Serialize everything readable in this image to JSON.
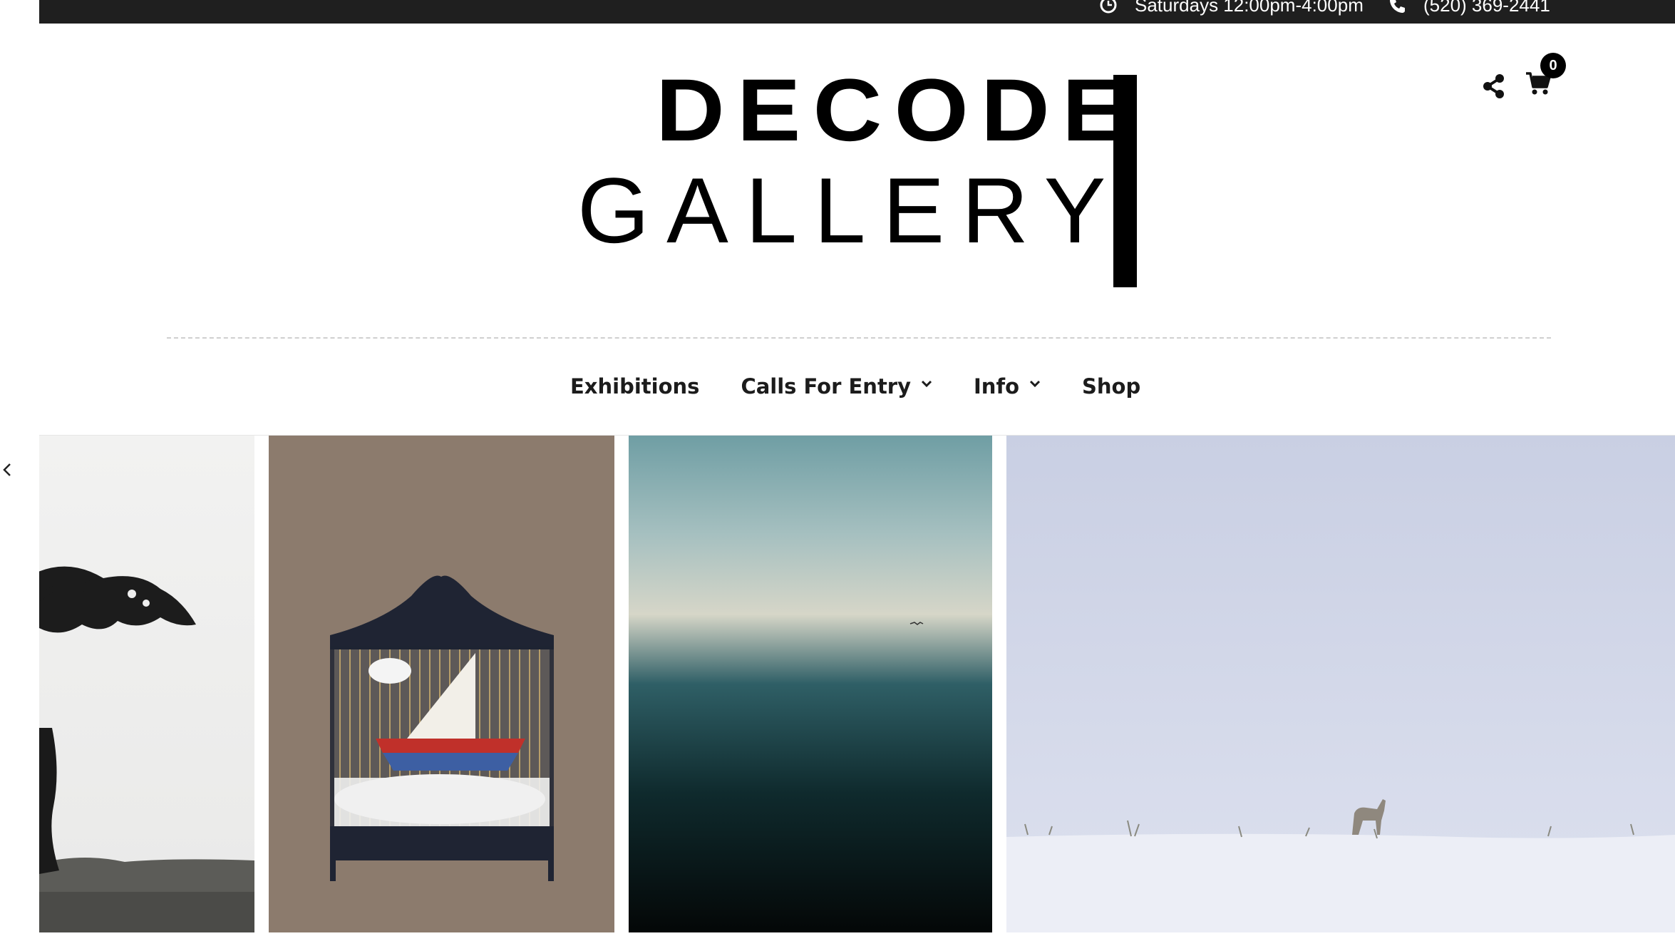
{
  "topbar": {
    "hours": "Saturdays 12:00pm-4:00pm",
    "phone": "(520) 369-2441",
    "background": "#1f1f1f"
  },
  "logo": {
    "line1": "DECODE",
    "line2": "GALLERY"
  },
  "header": {
    "share_icon": "share-icon",
    "cart_icon": "cart-icon",
    "cart_count": "0"
  },
  "nav": {
    "items": [
      {
        "label": "Exhibitions",
        "has_dropdown": false
      },
      {
        "label": "Calls For Entry",
        "has_dropdown": true
      },
      {
        "label": "Info",
        "has_dropdown": true
      },
      {
        "label": "Shop",
        "has_dropdown": false
      }
    ]
  },
  "slider": {
    "prev_icon": "chevron-left-icon",
    "slides": [
      {
        "name": "tree-photo"
      },
      {
        "name": "birdcage-sculpture"
      },
      {
        "name": "seascape-photo"
      },
      {
        "name": "coyote-in-snow-photo"
      }
    ]
  }
}
